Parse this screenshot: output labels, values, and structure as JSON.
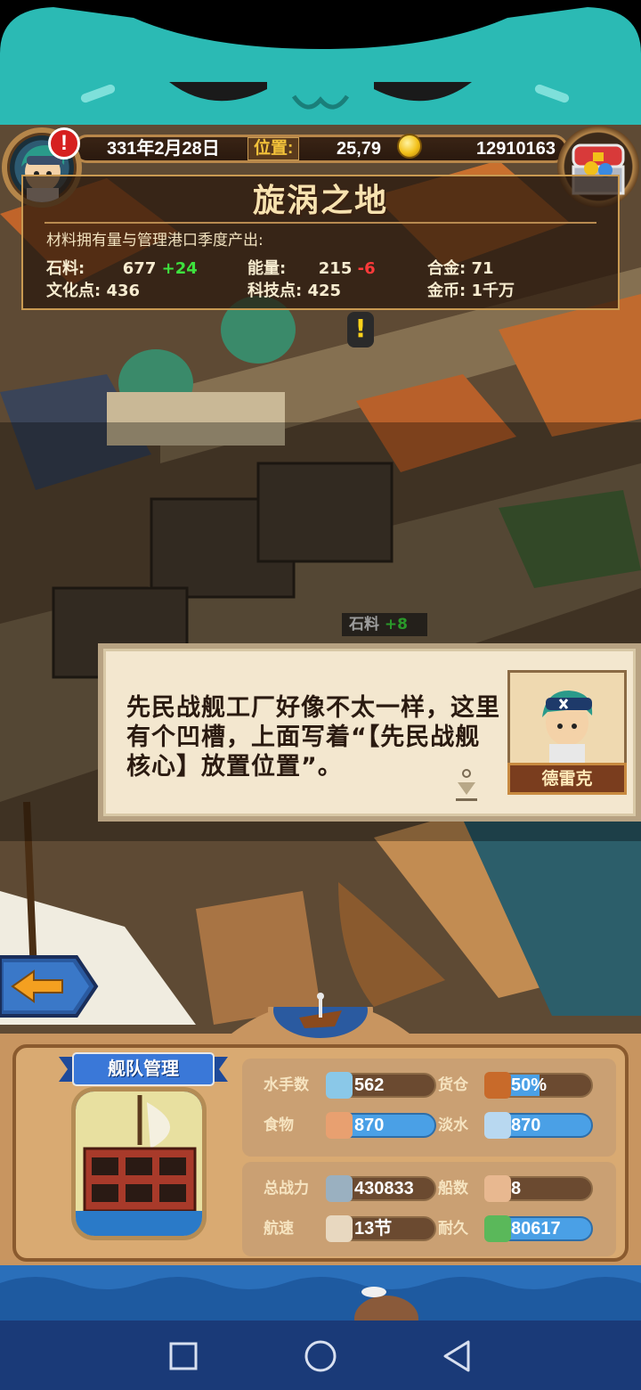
{
  "hud": {
    "date": "331年2月28日",
    "position_label": "位置:",
    "position_value": "25,79",
    "gold": "12910163",
    "alert": "!"
  },
  "region": {
    "name": "旋涡之地",
    "subtitle": "材料拥有量与管理港口季度产出:",
    "resources": [
      {
        "label": "石料:",
        "value": "677",
        "delta": "+24"
      },
      {
        "label": "能量:",
        "value": "215",
        "delta": "-6"
      },
      {
        "label": "合金:",
        "value": "71",
        "delta": ""
      },
      {
        "label": "文化点:",
        "value": "436",
        "delta": ""
      },
      {
        "label": "科技点:",
        "value": "425",
        "delta": ""
      },
      {
        "label": "金币:",
        "value": "1千万",
        "delta": ""
      }
    ]
  },
  "world": {
    "quest_marker": "!",
    "floating_resource_label": "石料",
    "floating_resource_delta": "+8"
  },
  "dialog": {
    "text": "先民战舰工厂好像不太一样，这里有个凹槽，上面写着“【先民战舰核心】放置位置”。",
    "speaker": "德雷克"
  },
  "fleet": {
    "title": "舰队管理",
    "stats": [
      {
        "label": "水手数",
        "value": "562",
        "icon": "sailor-icon"
      },
      {
        "label": "货仓",
        "value": "50%",
        "icon": "cargo-crate-icon",
        "fill": 0.5
      },
      {
        "label": "食物",
        "value": "870",
        "icon": "meat-icon"
      },
      {
        "label": "淡水",
        "value": "870",
        "icon": "water-jug-icon"
      },
      {
        "label": "总战力",
        "value": "430833",
        "icon": "crossed-swords-icon"
      },
      {
        "label": "船数",
        "value": "8",
        "icon": "ship-count-icon"
      },
      {
        "label": "航速",
        "value": "13节",
        "icon": "speed-boat-icon"
      },
      {
        "label": "耐久",
        "value": "80617",
        "icon": "hull-durability-icon"
      }
    ]
  },
  "nav": {
    "buttons": [
      "recent-apps",
      "home",
      "back"
    ]
  }
}
